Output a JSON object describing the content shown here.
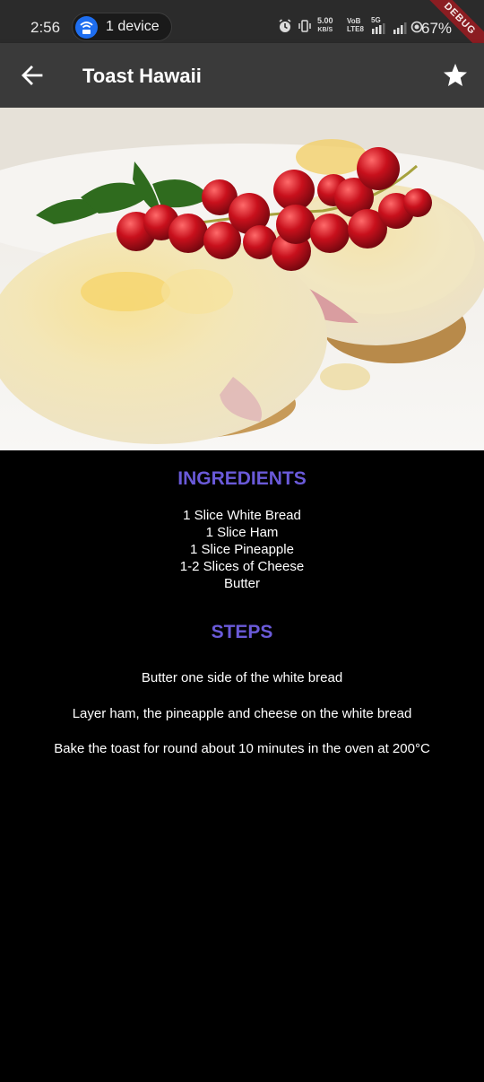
{
  "status_bar": {
    "time": "2:56",
    "device_pill_label": "1 device",
    "speed_value": "5.00",
    "speed_unit": "KB/S",
    "volte_top": "VoB",
    "volte_bottom": "LTE8",
    "network": "5G",
    "battery": "67%",
    "debug_banner": "DEBUG"
  },
  "app_bar": {
    "title": "Toast Hawaii",
    "back_icon": "arrow-back-icon",
    "favorite_icon": "star-icon"
  },
  "recipe": {
    "ingredients_heading": "INGREDIENTS",
    "ingredients": [
      "1 Slice White Bread",
      "1 Slice Ham",
      "1 Slice Pineapple",
      "1-2 Slices of Cheese",
      "Butter"
    ],
    "steps_heading": "STEPS",
    "steps": [
      "Butter one side of the white bread",
      "Layer ham, the pineapple and cheese on the white bread",
      "Bake the toast for round about 10 minutes in the oven at 200°C"
    ]
  },
  "colors": {
    "accent": "#6a5ad9",
    "app_bar": "#3a3a3a",
    "background": "#000000"
  }
}
